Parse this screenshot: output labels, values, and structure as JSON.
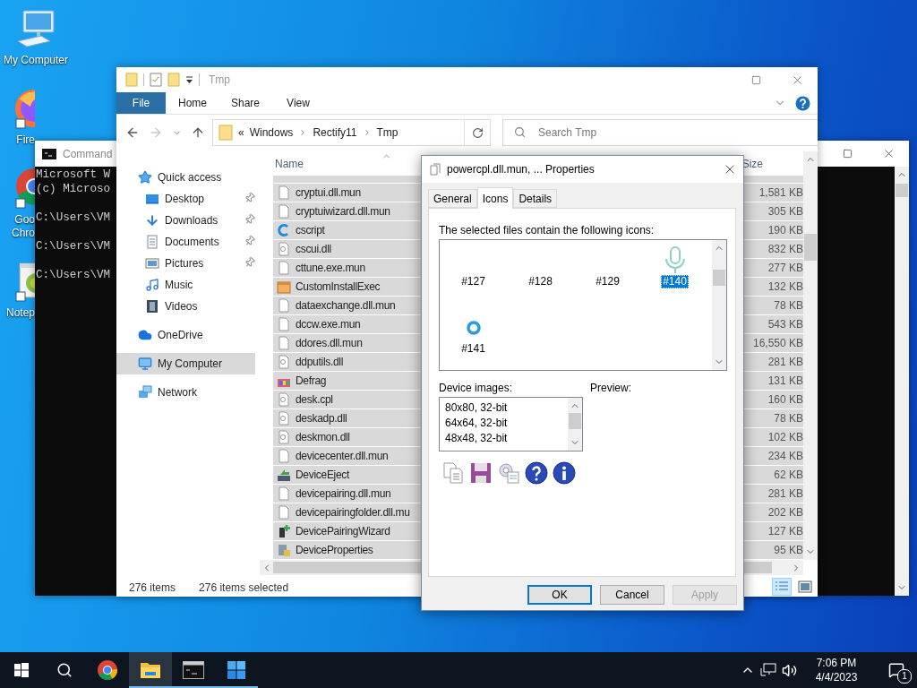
{
  "desktop_icons": [
    {
      "kind": "computer",
      "label": [
        "My Computer"
      ],
      "cut": false
    },
    {
      "kind": "firefox",
      "label": [
        "Fire"
      ],
      "cut": true
    },
    {
      "kind": "chrome",
      "label": [
        "Goo",
        "Chro"
      ],
      "cut": true
    },
    {
      "kind": "notepad",
      "label": [
        "Notep"
      ],
      "cut": true
    }
  ],
  "command_window": {
    "title": "Command",
    "blocks": [
      [
        "Microsoft W",
        "(c) Microso"
      ],
      [
        "C:\\Users\\VM"
      ],
      [
        "C:\\Users\\VM"
      ],
      [
        "C:\\Users\\VM"
      ]
    ]
  },
  "explorer": {
    "title": "Tmp",
    "ribbon_tabs": [
      {
        "label": "File",
        "kind": "file"
      },
      {
        "label": "Home",
        "kind": "tab"
      },
      {
        "label": "Share",
        "kind": "tab"
      },
      {
        "label": "View",
        "kind": "tab"
      }
    ],
    "address": {
      "overflow": "«",
      "path": [
        "Windows",
        "Rectify11",
        "Tmp"
      ]
    },
    "search": {
      "placeholder": "Search Tmp"
    },
    "nav": [
      {
        "label": "Quick access",
        "kind": "star",
        "selected": false,
        "children": [
          {
            "label": "Desktop",
            "kind": "desktop",
            "pinned": true,
            "selected": false
          },
          {
            "label": "Downloads",
            "kind": "downloads",
            "pinned": true,
            "selected": false
          },
          {
            "label": "Documents",
            "kind": "documents",
            "pinned": true,
            "selected": false
          },
          {
            "label": "Pictures",
            "kind": "pictures",
            "pinned": true,
            "selected": false
          },
          {
            "label": "Music",
            "kind": "music",
            "pinned": false,
            "selected": false
          },
          {
            "label": "Videos",
            "kind": "videos",
            "pinned": false,
            "selected": false
          }
        ]
      },
      {
        "label": "OneDrive",
        "kind": "cloud",
        "selected": false
      },
      {
        "label": "My Computer",
        "kind": "computer",
        "selected": true
      },
      {
        "label": "Network",
        "kind": "network",
        "selected": false
      }
    ],
    "columns": [
      "Name",
      "Size"
    ],
    "rows": [
      {
        "name": "cryptui.dll.mun",
        "size": "1,581 KB",
        "kind": "blank",
        "selected": true
      },
      {
        "name": "cryptuiwizard.dll.mun",
        "size": "305 KB",
        "kind": "blank",
        "selected": true
      },
      {
        "name": "cscript",
        "size": "190 KB",
        "kind": "script",
        "selected": true
      },
      {
        "name": "cscui.dll",
        "size": "832 KB",
        "kind": "dll",
        "selected": true
      },
      {
        "name": "cttune.exe.mun",
        "size": "277 KB",
        "kind": "blank",
        "selected": true
      },
      {
        "name": "CustomInstallExec",
        "size": "132 KB",
        "kind": "installer",
        "selected": true
      },
      {
        "name": "dataexchange.dll.mun",
        "size": "78 KB",
        "kind": "blank",
        "selected": true
      },
      {
        "name": "dccw.exe.mun",
        "size": "543 KB",
        "kind": "blank",
        "selected": true
      },
      {
        "name": "ddores.dll.mun",
        "size": "16,550 KB",
        "kind": "blank",
        "selected": true
      },
      {
        "name": "ddputils.dll",
        "size": "281 KB",
        "kind": "dll",
        "selected": true
      },
      {
        "name": "Defrag",
        "size": "131 KB",
        "kind": "defrag",
        "selected": true
      },
      {
        "name": "desk.cpl",
        "size": "160 KB",
        "kind": "dll",
        "selected": true
      },
      {
        "name": "deskadp.dll",
        "size": "78 KB",
        "kind": "dll",
        "selected": true
      },
      {
        "name": "deskmon.dll",
        "size": "102 KB",
        "kind": "dll",
        "selected": true
      },
      {
        "name": "devicecenter.dll.mun",
        "size": "234 KB",
        "kind": "blank",
        "selected": true
      },
      {
        "name": "DeviceEject",
        "size": "62 KB",
        "kind": "eject",
        "selected": true
      },
      {
        "name": "devicepairing.dll.mun",
        "size": "281 KB",
        "kind": "blank",
        "selected": true
      },
      {
        "name": "devicepairingfolder.dll.mu",
        "size": "202 KB",
        "kind": "blank",
        "selected": true
      },
      {
        "name": "DevicePairingWizard",
        "size": "127 KB",
        "kind": "pairing",
        "selected": true
      },
      {
        "name": "DeviceProperties",
        "size": "95 KB",
        "kind": "properties",
        "selected": true
      }
    ],
    "status": {
      "count": "276 items",
      "selection": "276 items selected"
    },
    "view_buttons": [
      {
        "kind": "details",
        "selected": true
      },
      {
        "kind": "thumbnails",
        "selected": false
      }
    ]
  },
  "dialog": {
    "title": "powercpl.dll.mun, ... Properties",
    "tabs": [
      {
        "label": "General",
        "selected": false
      },
      {
        "label": "Icons",
        "selected": true
      },
      {
        "label": "Details",
        "selected": false
      }
    ],
    "prompt": "The selected files contain the following icons:",
    "icons": [
      {
        "label": "#127",
        "kind": "empty",
        "selected": false
      },
      {
        "label": "#128",
        "kind": "empty",
        "selected": false
      },
      {
        "label": "#129",
        "kind": "empty",
        "selected": false
      },
      {
        "label": "#140",
        "kind": "microphone",
        "selected": true
      },
      {
        "label": "#141",
        "kind": "ring",
        "selected": false
      }
    ],
    "device_images": {
      "label": "Device images:",
      "items": [
        "80x80, 32-bit",
        "64x64, 32-bit",
        "48x48, 32-bit"
      ]
    },
    "preview_label": "Preview:",
    "tools": [
      {
        "kind": "copy"
      },
      {
        "kind": "save"
      },
      {
        "kind": "export"
      },
      {
        "kind": "help"
      },
      {
        "kind": "info"
      }
    ],
    "buttons": [
      {
        "label": "OK",
        "default": true,
        "disabled": false
      },
      {
        "label": "Cancel",
        "default": false,
        "disabled": false
      },
      {
        "label": "Apply",
        "default": false,
        "disabled": true
      }
    ]
  },
  "taskbar": {
    "apps": [
      {
        "kind": "start",
        "running": false,
        "active": false
      },
      {
        "kind": "search",
        "running": false,
        "active": false
      },
      {
        "kind": "chrome",
        "running": false,
        "active": false
      },
      {
        "kind": "explorer",
        "running": true,
        "active": true
      },
      {
        "kind": "terminal",
        "running": true,
        "active": false
      },
      {
        "kind": "tiles",
        "running": true,
        "active": false
      }
    ],
    "tray": {
      "time": "7:06 PM",
      "date": "4/4/2023",
      "notifications": "1"
    }
  }
}
